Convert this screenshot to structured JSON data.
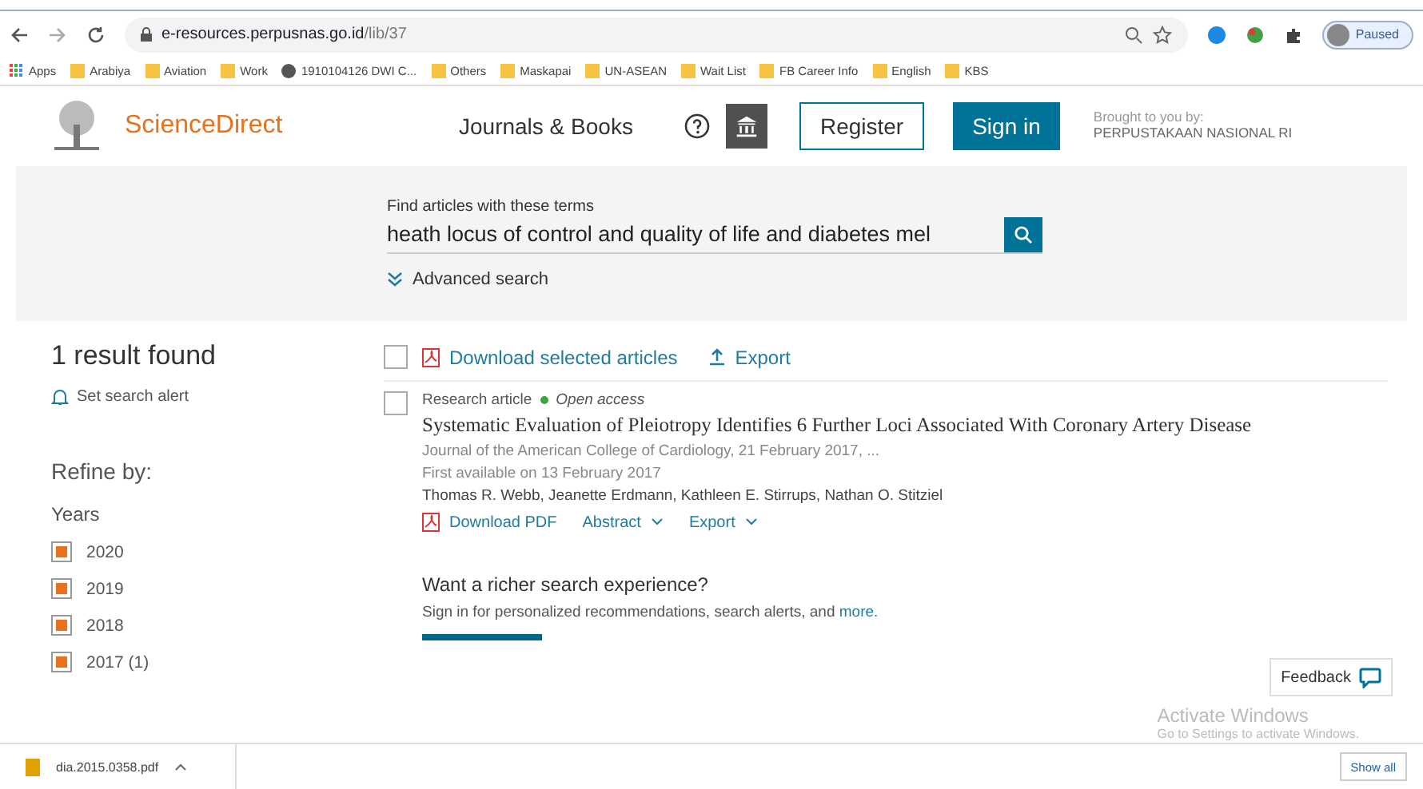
{
  "browser": {
    "url_host": "e-resources.perpusnas.go.id",
    "url_path": "/lib/37",
    "profile": "Paused",
    "bookmarks": [
      {
        "label": "Apps",
        "kind": "apps"
      },
      {
        "label": "Arabiya",
        "kind": "folder"
      },
      {
        "label": "Aviation",
        "kind": "folder"
      },
      {
        "label": "Work",
        "kind": "folder"
      },
      {
        "label": "1910104126 DWI C...",
        "kind": "site"
      },
      {
        "label": "Others",
        "kind": "folder"
      },
      {
        "label": "Maskapai",
        "kind": "folder"
      },
      {
        "label": "UN-ASEAN",
        "kind": "folder"
      },
      {
        "label": "Wait List",
        "kind": "folder"
      },
      {
        "label": "FB Career Info",
        "kind": "folder"
      },
      {
        "label": "English",
        "kind": "folder"
      },
      {
        "label": "KBS",
        "kind": "folder"
      }
    ]
  },
  "header": {
    "logo": "ScienceDirect",
    "nav": "Journals & Books",
    "register": "Register",
    "sign_in": "Sign in",
    "brought_label": "Brought to you by:",
    "brought_by": "PERPUSTAKAAN NASIONAL RI"
  },
  "search": {
    "label": "Find articles with these terms",
    "value": "heath locus of control and quality of life and diabetes mel",
    "advanced": "Advanced search"
  },
  "sidebar": {
    "result_count": "1 result found",
    "alert": "Set search alert",
    "refine": "Refine by:",
    "years_label": "Years",
    "years": [
      {
        "label": "2020",
        "checked": true
      },
      {
        "label": "2019",
        "checked": true
      },
      {
        "label": "2018",
        "checked": true
      },
      {
        "label": "2017 (1)",
        "checked": true
      }
    ]
  },
  "results": {
    "select_all_checked": false,
    "download_selected": "Download selected articles",
    "export": "Export",
    "items": [
      {
        "checked": false,
        "type": "Research article",
        "access": "Open access",
        "title": "Systematic Evaluation of Pleiotropy Identifies 6 Further Loci Associated With Coronary Artery Disease",
        "journal": "Journal of the American College of Cardiology, 21 February 2017, ...",
        "available": "First available on 13 February 2017",
        "authors": "Thomas R. Webb, Jeanette Erdmann, Kathleen E. Stirrups, Nathan O. Stitziel",
        "download_pdf": "Download PDF",
        "abstract": "Abstract",
        "export": "Export"
      }
    ],
    "promo_title": "Want a richer search experience?",
    "promo_text": "Sign in for personalized recommendations, search alerts, and",
    "promo_link": "more."
  },
  "feedback": "Feedback",
  "os_overlay": {
    "title": "Activate Windows",
    "text": "Go to Settings to activate Windows."
  },
  "download_bar": {
    "file": "dia.2015.0358.pdf",
    "show_all": "Show all"
  }
}
